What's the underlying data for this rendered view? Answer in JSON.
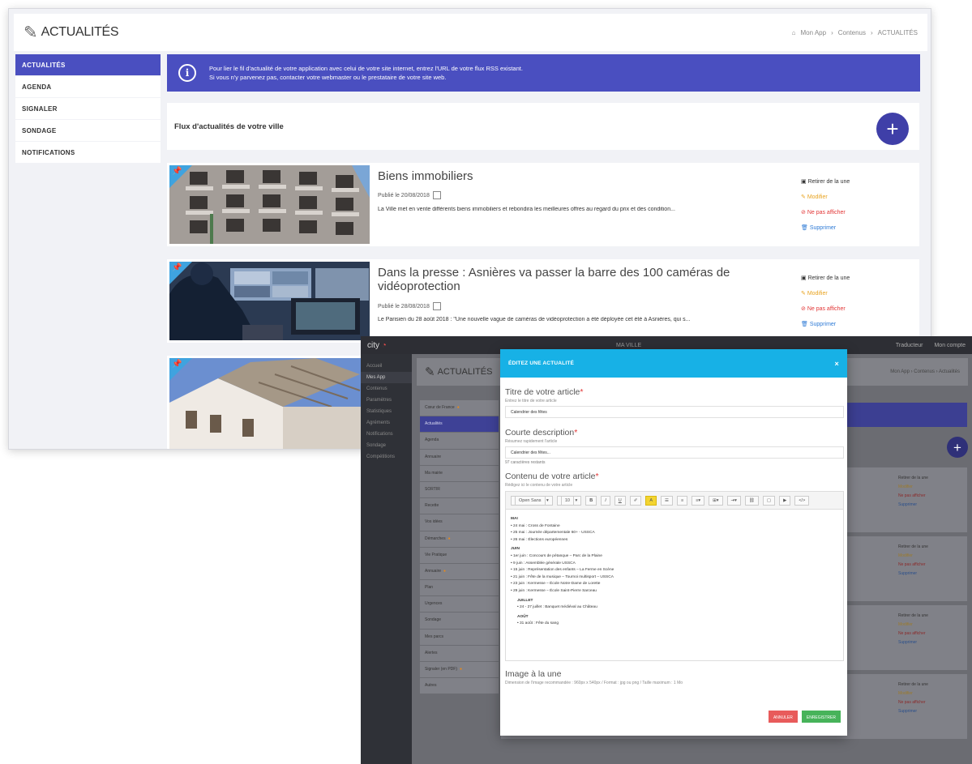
{
  "back": {
    "title": "ACTUALITÉS",
    "breadcrumb": [
      "Mon App",
      "Contenus",
      "ACTUALITÉS"
    ],
    "sidebar": [
      {
        "label": "ACTUALITÉS",
        "active": true
      },
      {
        "label": "AGENDA"
      },
      {
        "label": "SIGNALER"
      },
      {
        "label": "SONDAGE"
      },
      {
        "label": "NOTIFICATIONS"
      }
    ],
    "info_line1": "Pour lier le fil d'actualité de votre application avec celui de votre site internet, entrez l'URL de votre flux RSS existant.",
    "info_line2": "Si vous n'y parvenez pas, contacter votre webmaster ou le prestataire de votre site web.",
    "feed_title": "Flux d'actualités de votre ville",
    "actions": [
      "Retirer de la une",
      "Modifier",
      "Ne pas afficher",
      "Supprimer"
    ],
    "cards": [
      {
        "title": "Biens immobiliers",
        "date": "Publié le 20/08/2018",
        "excerpt": "La Ville met en vente différents biens immobiliers et rebondira les meilleures offres au regard du prix et des condition..."
      },
      {
        "title": "Dans la presse : Asnières va passer la barre des 100 caméras de vidéoprotection",
        "date": "Publié le 28/08/2018",
        "excerpt": "Le Parisien du 28 août 2018 : \"Une nouvelle vague de caméras de vidéoprotection a été déployée cet été à Asnières, qui s..."
      }
    ]
  },
  "front": {
    "app_name": "city",
    "window_title": "MA VILLE",
    "top_right": [
      "Traducteur",
      "Mon compte"
    ],
    "nav": [
      "Accueil",
      "Mes App",
      "Contenus",
      "Paramètres",
      "Statistiques",
      "Agréments",
      "Notifications",
      "Sondage",
      "Compétitions"
    ],
    "page_title": "ACTUALITÉS",
    "breadcrumb": "Mon App › Contenus › Actualités",
    "side": [
      {
        "label": "Cœur de France",
        "dot": true
      },
      {
        "label": "Actualités",
        "active": true
      },
      {
        "label": "Agenda"
      },
      {
        "label": "Annuaire"
      },
      {
        "label": "Ma mairie"
      },
      {
        "label": "SORTIR"
      },
      {
        "label": "Recette"
      },
      {
        "label": "Vos idées"
      },
      {
        "label": "Démarches",
        "dot": true
      },
      {
        "label": "Vie Pratique"
      },
      {
        "label": "Annuaire",
        "dot": true
      },
      {
        "label": "Plan"
      },
      {
        "label": "Urgences"
      },
      {
        "label": "Sondage"
      },
      {
        "label": "Mes parcs"
      },
      {
        "label": "Alertes"
      },
      {
        "label": "Signaler (en PDF)",
        "dot": true
      },
      {
        "label": "Autres"
      }
    ],
    "card_actions": [
      "Retirer de la une",
      "Modifier",
      "Ne pas afficher",
      "Supprimer"
    ]
  },
  "modal": {
    "header": "ÉDITEZ UNE ACTUALITÉ",
    "title_label": "Titre de votre article",
    "title_help": "Entrez le titre de votre article",
    "title_value": "Calendrier des fêtes",
    "desc_label": "Courte description",
    "desc_help": "Résumez rapidement l'article",
    "desc_value": "Calendrier des fêtes...",
    "desc_count": "97 caractères restants",
    "content_label": "Contenu de votre article",
    "content_help": "Rédigez ici le contenu de votre article",
    "toolbar_font": "Open Sans",
    "toolbar_size": "10",
    "editor_lines": [
      {
        "t": "MAI",
        "k": "g"
      },
      {
        "t": "24 mai : Cross de Fontaine",
        "k": "r"
      },
      {
        "t": "25 mai : Journée départementale 60+ - USSCA",
        "k": "r"
      },
      {
        "t": "26 mai : Élections européennes",
        "k": "r"
      },
      {
        "t": "JUIN",
        "k": "g"
      },
      {
        "t": "1er juin : Concours de pétanque – Parc de la Plaine",
        "k": "r"
      },
      {
        "t": "9 juin : Assemblée générale USSCA",
        "k": "r"
      },
      {
        "t": "15 juin : Représentation des enfants – La Ferme en Scène",
        "k": "r"
      },
      {
        "t": "21 juin : Fête de la musique – Tournoi multisport – USSCA",
        "k": "r"
      },
      {
        "t": "23 juin : Kermesse – École Notre-Dame de Lorette",
        "k": "r"
      },
      {
        "t": "29 juin : Kermesse – École Saint-Pierre Sarceau",
        "k": "r"
      },
      {
        "t": "JUILLET",
        "k": "g ind"
      },
      {
        "t": "24 - 27 juillet : Banquet médiéval au Château",
        "k": "r ind"
      },
      {
        "t": "AOÛT",
        "k": "g ind"
      },
      {
        "t": "31 août : Fête du sang",
        "k": "r ind"
      }
    ],
    "image_label": "Image à la une",
    "image_help": "Dimension de l'image recommandée : 960px x 540px / Format : jpg ou png / Taille maximum : 1 Mo",
    "cancel": "ANNULER",
    "save": "ENREGISTRER"
  }
}
